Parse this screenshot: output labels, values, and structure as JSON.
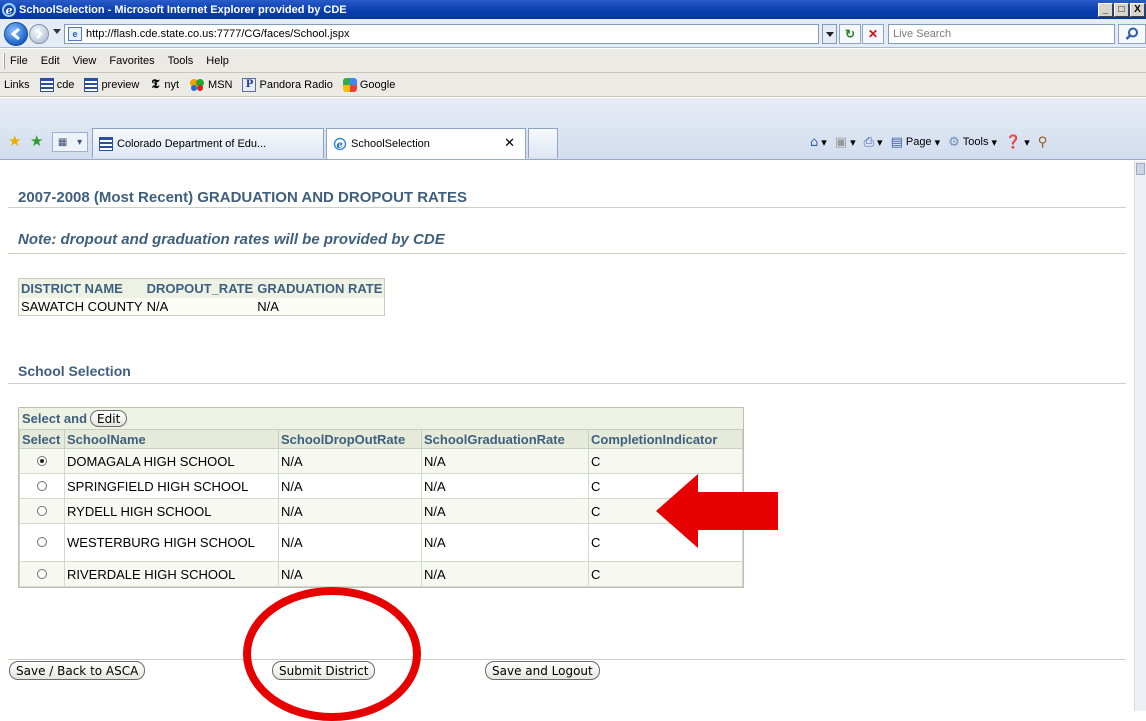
{
  "window": {
    "title": "SchoolSelection - Microsoft Internet Explorer provided by CDE",
    "min_label": "_",
    "max_label": "□",
    "close_label": "X"
  },
  "address_bar": {
    "url": "http://flash.cde.state.co.us:7777/CG/faces/School.jspx",
    "search_placeholder": "Live Search"
  },
  "menu": [
    "File",
    "Edit",
    "View",
    "Favorites",
    "Tools",
    "Help"
  ],
  "links_bar": {
    "label": "Links",
    "items": [
      "cde",
      "preview",
      "nyt",
      "MSN",
      "Pandora Radio",
      "Google"
    ]
  },
  "tabs": [
    {
      "label": "Colorado Department of Edu...",
      "icon": "cde-icon",
      "active": false
    },
    {
      "label": "SchoolSelection",
      "icon": "ie-page-icon",
      "active": true
    }
  ],
  "command_bar": {
    "page": "Page",
    "tools": "Tools"
  },
  "page": {
    "title": "2007-2008 (Most Recent) GRADUATION AND DROPOUT RATES",
    "note": "Note: dropout and graduation rates will be provided by CDE",
    "district_table": {
      "headers": [
        "DISTRICT NAME",
        "DROPOUT_RATE",
        "GRADUATION RATE"
      ],
      "rows": [
        [
          "SAWATCH COUNTY",
          "N/A",
          "N/A"
        ]
      ]
    },
    "section_title": "School Selection",
    "selection": {
      "toolbar_text": "Select and",
      "edit_label": "Edit",
      "headers": [
        "Select",
        "SchoolName",
        "SchoolDropOutRate",
        "SchoolGraduationRate",
        "CompletionIndicator"
      ],
      "rows": [
        {
          "name": "DOMAGALA HIGH SCHOOL",
          "dropout": "N/A",
          "grad": "N/A",
          "completion": "C",
          "selected": true
        },
        {
          "name": "SPRINGFIELD HIGH SCHOOL",
          "dropout": "N/A",
          "grad": "N/A",
          "completion": "C",
          "selected": false
        },
        {
          "name": "RYDELL HIGH SCHOOL",
          "dropout": "N/A",
          "grad": "N/A",
          "completion": "C",
          "selected": false
        },
        {
          "name": "WESTERBURG HIGH SCHOOL",
          "dropout": "N/A",
          "grad": "N/A",
          "completion": "C",
          "selected": false
        },
        {
          "name": "RIVERDALE HIGH SCHOOL",
          "dropout": "N/A",
          "grad": "N/A",
          "completion": "C",
          "selected": false
        }
      ]
    },
    "buttons": {
      "save_back": "Save / Back to ASCA",
      "submit": "Submit District",
      "save_logout": "Save and Logout"
    }
  },
  "colors": {
    "heading": "#3f5f7e",
    "annotation": "#e60000"
  }
}
